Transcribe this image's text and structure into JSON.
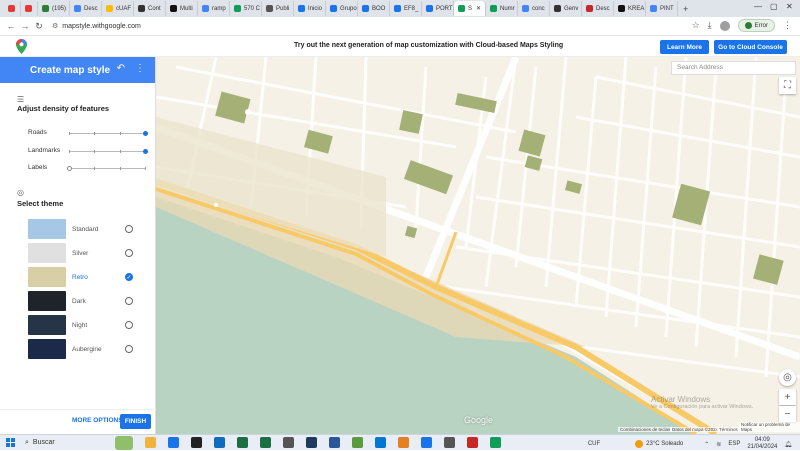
{
  "browser": {
    "tabs": [
      {
        "label": "",
        "color": "#e53935"
      },
      {
        "label": "",
        "color": "#e53935"
      },
      {
        "label": "(195)",
        "color": "#2e7d32"
      },
      {
        "label": "Desc",
        "color": "#4285f4"
      },
      {
        "label": "cUAF",
        "color": "#fbbc05"
      },
      {
        "label": "Cont",
        "color": "#333333"
      },
      {
        "label": "Multi",
        "color": "#111111"
      },
      {
        "label": "ramp",
        "color": "#4285f4"
      },
      {
        "label": "570 C",
        "color": "#0f9d58"
      },
      {
        "label": "Publi",
        "color": "#555555"
      },
      {
        "label": "Inicio",
        "color": "#1a73e8"
      },
      {
        "label": "Grupo",
        "color": "#1a73e8"
      },
      {
        "label": "BOO",
        "color": "#1a73e8"
      },
      {
        "label": "EF8_",
        "color": "#1a73e8"
      },
      {
        "label": "PORT",
        "color": "#1a73e8"
      },
      {
        "label": "S",
        "color": "#0f9d58"
      },
      {
        "label": "Numr",
        "color": "#0f9d58"
      },
      {
        "label": "conc",
        "color": "#4285f4"
      },
      {
        "label": "Genv",
        "color": "#333333"
      },
      {
        "label": "Desc",
        "color": "#c62828"
      },
      {
        "label": "KREA",
        "color": "#111111"
      },
      {
        "label": "PINT",
        "color": "#4285f4"
      }
    ],
    "new_tab": "+",
    "url": "mapstyle.withgoogle.com",
    "profile_status": "Error",
    "window_controls": {
      "min": "—",
      "max": "▢",
      "close": "✕"
    }
  },
  "banner": {
    "text": "Try out the next generation of map customization with Cloud-based Maps Styling",
    "learn_more": "Learn More",
    "cloud_console": "Go to Cloud Console"
  },
  "panel": {
    "title": "Create map style",
    "density_title": "Adjust density of features",
    "sliders": [
      {
        "label": "Roads",
        "level": 1.0
      },
      {
        "label": "Landmarks",
        "level": 1.0
      },
      {
        "label": "Labels",
        "level": 0.0
      }
    ],
    "theme_title": "Select theme",
    "themes": [
      {
        "name": "Standard",
        "selected": false,
        "color": "#a7c7e7"
      },
      {
        "name": "Silver",
        "selected": false,
        "color": "#e0e0e0"
      },
      {
        "name": "Retro",
        "selected": true,
        "color": "#d9cfa6"
      },
      {
        "name": "Dark",
        "selected": false,
        "color": "#1f232a"
      },
      {
        "name": "Night",
        "selected": false,
        "color": "#263447"
      },
      {
        "name": "Aubergine",
        "selected": false,
        "color": "#1c2a4a"
      }
    ],
    "more_options": "MORE OPTIONS",
    "finish": "FINISH"
  },
  "map": {
    "search_placeholder": "Search Address",
    "logo": "Google",
    "attribution": [
      "Combinaciones de teclas",
      "Datos del mapa ©2024",
      "Términos",
      "Notificar un problema de Maps"
    ],
    "watermark_title": "Activar Windows",
    "watermark_sub": "Ve a Configuración para activar Windows."
  },
  "taskbar": {
    "search": "Buscar",
    "currency": "CUF",
    "weather": "23°C  Soleado",
    "lang": "ESP",
    "time": "04:09",
    "date": "21/04/2024"
  },
  "colors": {
    "accent": "#1a73e8",
    "panel_header": "#4285f4",
    "map_land": "#f5f1e6",
    "map_water": "#b9d3c2",
    "map_highway": "#f8c967",
    "map_park": "#a5b076"
  }
}
